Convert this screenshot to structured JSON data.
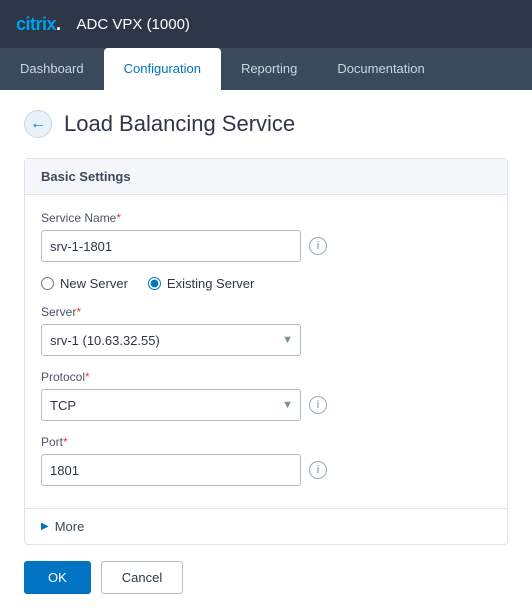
{
  "topbar": {
    "logo": "citrix.",
    "app_title": "ADC VPX (1000)"
  },
  "nav": {
    "tabs": [
      {
        "id": "dashboard",
        "label": "Dashboard",
        "active": false
      },
      {
        "id": "configuration",
        "label": "Configuration",
        "active": true
      },
      {
        "id": "reporting",
        "label": "Reporting",
        "active": false
      },
      {
        "id": "documentation",
        "label": "Documentation",
        "active": false
      }
    ]
  },
  "page": {
    "back_button": "←",
    "title": "Load Balancing Service"
  },
  "form": {
    "section_title": "Basic Settings",
    "service_name_label": "Service Name",
    "service_name_value": "srv-1-1801",
    "service_name_required": "*",
    "radio_new_server": "New Server",
    "radio_existing_server": "Existing Server",
    "server_label": "Server",
    "server_required": "*",
    "server_value": "srv-1 (10.63.32.55)",
    "protocol_label": "Protocol",
    "protocol_required": "*",
    "protocol_value": "TCP",
    "port_label": "Port",
    "port_required": "*",
    "port_value": "1801",
    "more_label": "More",
    "ok_label": "OK",
    "cancel_label": "Cancel"
  }
}
